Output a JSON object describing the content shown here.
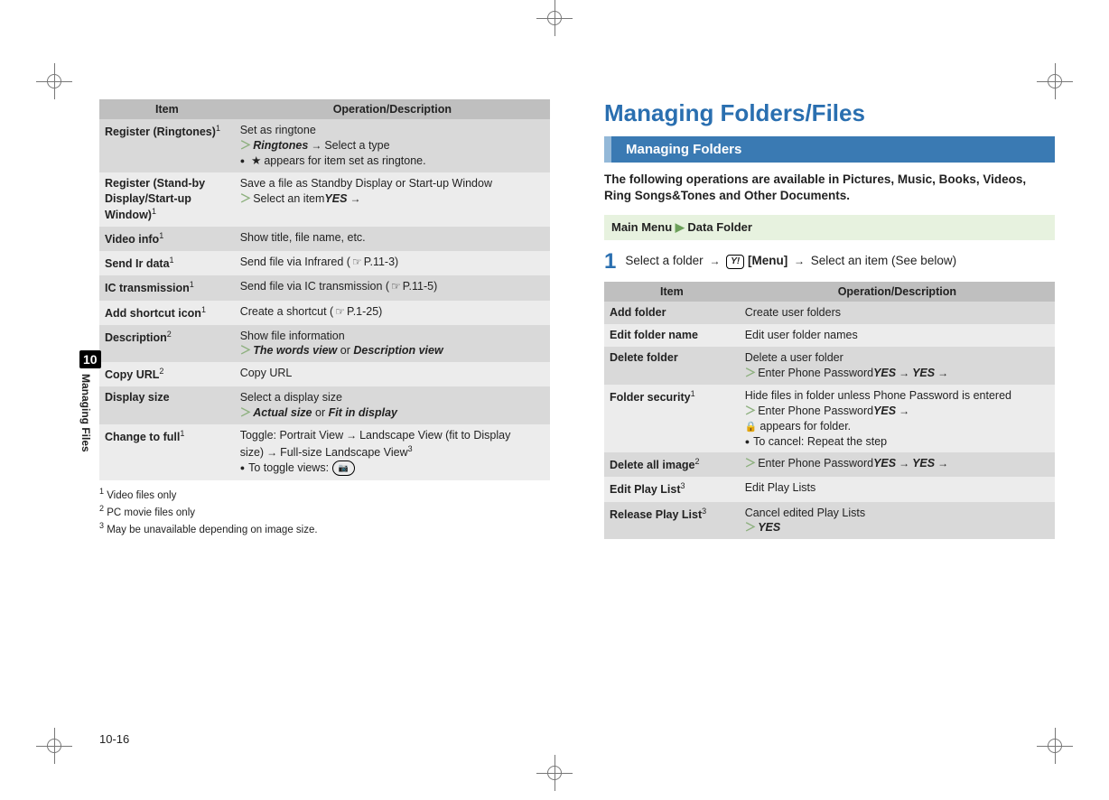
{
  "sidebar": {
    "chapter": "10",
    "label": "Managing Files"
  },
  "pageNumber": "10-16",
  "leftTable": {
    "headItem": "Item",
    "headOp": "Operation/Description",
    "rows": [
      {
        "item": "Register (Ringtones)",
        "sup": "1",
        "lines": [
          {
            "plain": "Set as ringtone"
          },
          {
            "chev": true,
            "bi": "Ringtones",
            "arrow": true,
            "tail": "Select a type"
          },
          {
            "bullet": true,
            "star": true,
            "tail": "appears for item set as ringtone."
          }
        ]
      },
      {
        "item": "Register (Stand-by Display/Start-up Window)",
        "sup": "1",
        "lines": [
          {
            "plain": "Save a file as Standby Display or Start-up Window"
          },
          {
            "chev": true,
            "plainhead": "Select an item",
            "arrow": true,
            "bi": "YES"
          }
        ]
      },
      {
        "item": "Video info",
        "sup": "1",
        "lines": [
          {
            "plain": "Show title, file name, etc."
          }
        ]
      },
      {
        "item": "Send Ir data",
        "sup": "1",
        "lines": [
          {
            "plainhead": "Send file via Infrared (",
            "hand": true,
            "tail": "P.11-3)"
          }
        ]
      },
      {
        "item": "IC transmission",
        "sup": "1",
        "lines": [
          {
            "plainhead": "Send file via IC transmission (",
            "hand": true,
            "tail": "P.11-5)"
          }
        ]
      },
      {
        "item": "Add shortcut icon",
        "sup": "1",
        "lines": [
          {
            "plainhead": "Create a shortcut (",
            "hand": true,
            "tail": "P.1-25)"
          }
        ]
      },
      {
        "item": "Description",
        "sup": "2",
        "lines": [
          {
            "plain": "Show file information"
          },
          {
            "chev": true,
            "bi": "The words view",
            "plainmid": " or ",
            "bi2": "Description view"
          }
        ]
      },
      {
        "item": "Copy URL",
        "sup": "2",
        "lines": [
          {
            "plain": "Copy URL"
          }
        ]
      },
      {
        "item": "Display size",
        "sup": "",
        "lines": [
          {
            "plain": "Select a display size"
          },
          {
            "chev": true,
            "bi": "Actual size",
            "plainmid": " or ",
            "bi2": "Fit in display"
          }
        ]
      },
      {
        "item": "Change to full",
        "sup": "1",
        "lines": [
          {
            "plainhead": "Toggle: Portrait View",
            "arrow": true,
            "plainmid2": "Landscape View (fit to Display size)",
            "arrow2": true,
            "tail": "Full-size Landscape View",
            "supTail": "3"
          },
          {
            "bullet": true,
            "plainhead": "To toggle views: ",
            "cam": true
          }
        ]
      }
    ],
    "footnotes": [
      {
        "n": "1",
        "t": "Video files only"
      },
      {
        "n": "2",
        "t": "PC movie files only"
      },
      {
        "n": "3",
        "t": "May be unavailable depending on image size."
      }
    ]
  },
  "right": {
    "title": "Managing Folders/Files",
    "subhead": "Managing Folders",
    "intro": "The following operations are available in Pictures, Music, Books, Videos, Ring Songs&Tones and Other Documents.",
    "menu": {
      "a": "Main Menu",
      "b": "Data Folder"
    },
    "step": {
      "n": "1",
      "a": "Select a folder",
      "menuLabel": "[Menu]",
      "c": "Select an item (See below)"
    },
    "table": {
      "headItem": "Item",
      "headOp": "Operation/Description",
      "rows": [
        {
          "item": "Add folder",
          "sup": "",
          "lines": [
            {
              "plain": "Create user folders"
            }
          ]
        },
        {
          "item": "Edit folder name",
          "sup": "",
          "lines": [
            {
              "plain": "Edit user folder names"
            }
          ]
        },
        {
          "item": "Delete folder",
          "sup": "",
          "lines": [
            {
              "plain": "Delete a user folder"
            },
            {
              "chev": true,
              "plainhead": "Enter Phone Password",
              "arrow": true,
              "bi": "YES",
              "arrow2": true,
              "bi2": "YES"
            }
          ]
        },
        {
          "item": "Folder security",
          "sup": "1",
          "lines": [
            {
              "plain": "Hide files in folder unless Phone Password is entered"
            },
            {
              "chev": true,
              "plainhead": "Enter Phone Password",
              "arrow": true,
              "bi": "YES"
            },
            {
              "lock": true,
              "tail": "appears for folder."
            },
            {
              "bullet": true,
              "plain": "To cancel: Repeat the step"
            }
          ]
        },
        {
          "item": "Delete all image",
          "sup": "2",
          "lines": [
            {
              "chev": true,
              "plainhead": "Enter Phone Password",
              "arrow": true,
              "bi": "YES",
              "arrow2": true,
              "bi2": "YES"
            }
          ]
        },
        {
          "item": "Edit Play List",
          "sup": "3",
          "lines": [
            {
              "plain": "Edit Play Lists"
            }
          ]
        },
        {
          "item": "Release Play List",
          "sup": "3",
          "lines": [
            {
              "plain": "Cancel edited Play Lists"
            },
            {
              "chev": true,
              "bi": "YES"
            }
          ]
        }
      ]
    }
  }
}
